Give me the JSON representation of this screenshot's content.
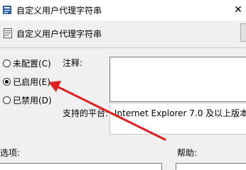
{
  "window": {
    "title": "自定义用户代理字符串"
  },
  "header": {
    "policy_title": "自定义用户代理字符串"
  },
  "state": {
    "options": [
      {
        "label": "未配置(C)",
        "selected": false
      },
      {
        "label": "已启用(E)",
        "selected": true
      },
      {
        "label": "已禁用(D)",
        "selected": false
      }
    ]
  },
  "comment": {
    "label": "注释:"
  },
  "supported": {
    "label": "支持的平台:",
    "value": "Internet Explorer 7.0 及以上版本"
  },
  "options_section": {
    "label": "选项:"
  },
  "help_section": {
    "label": "帮助:"
  },
  "colors": {
    "arrow": "#e02020",
    "window_bg": "#f0f0f0"
  },
  "icons": {
    "app": "policy-app-icon",
    "policy": "policy-document-icon",
    "close": "close-icon"
  }
}
